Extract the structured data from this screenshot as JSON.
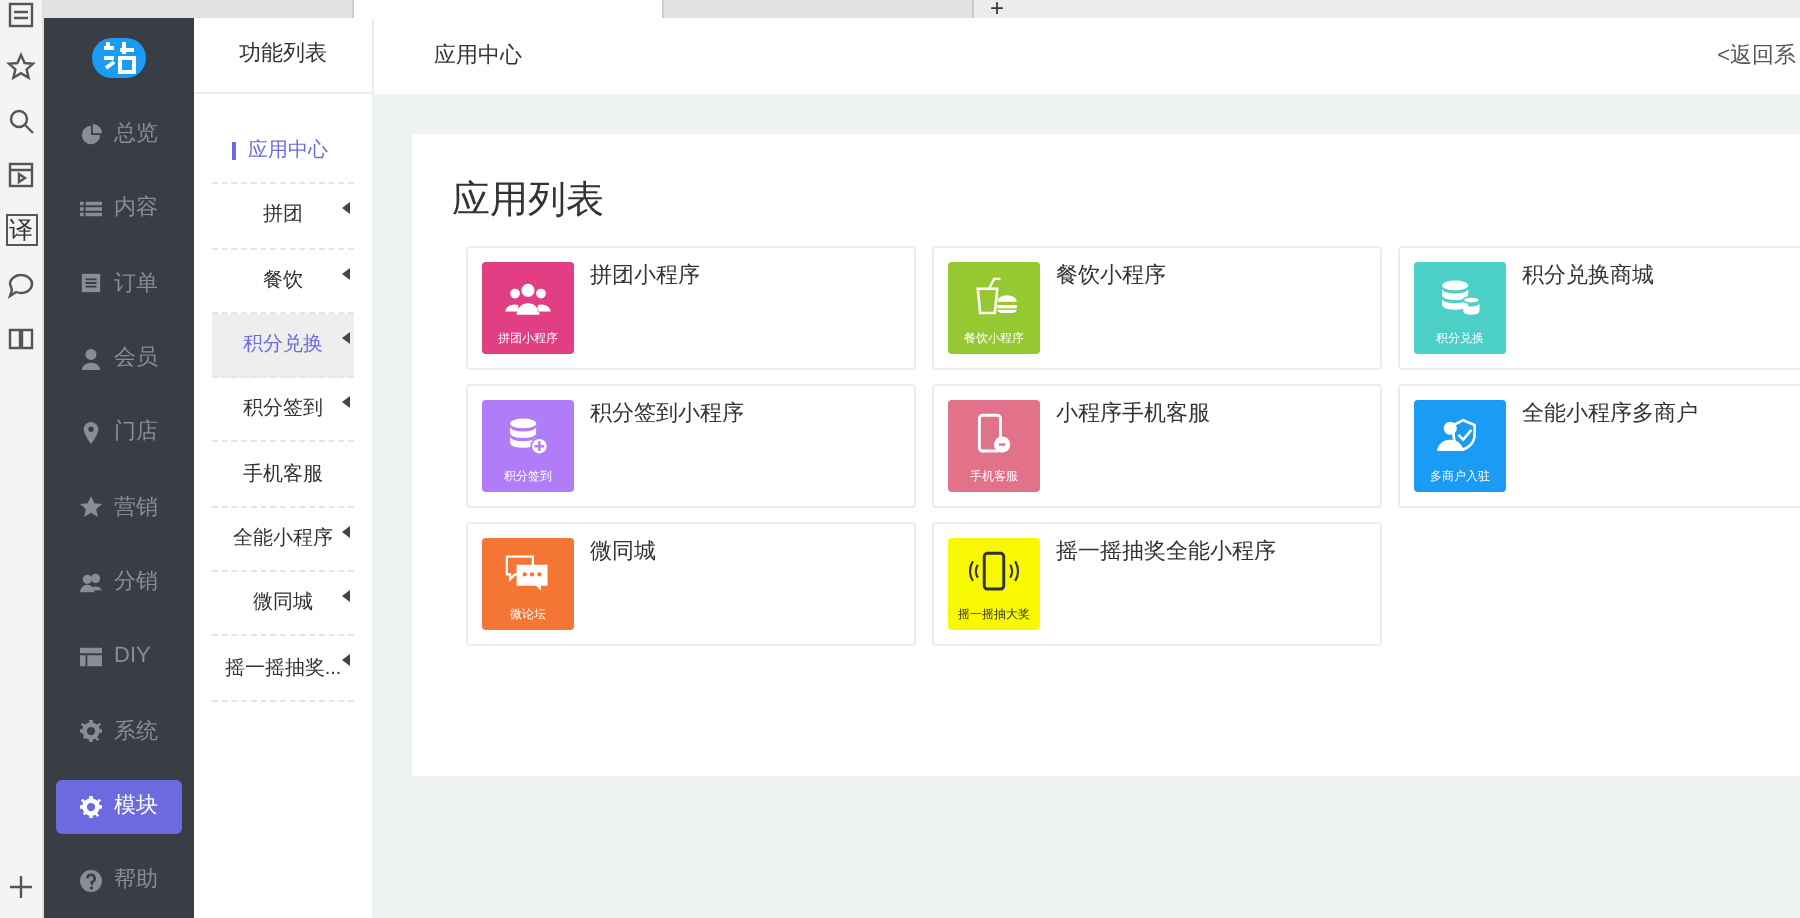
{
  "browser_sidebar": {
    "items": [
      {
        "kind": "list"
      },
      {
        "kind": "star"
      },
      {
        "kind": "search"
      },
      {
        "kind": "video"
      },
      {
        "kind": "glyph",
        "text": "译"
      },
      {
        "kind": "chat"
      },
      {
        "kind": "book"
      },
      {
        "kind": "plus"
      }
    ]
  },
  "browser_tabs": {
    "tabs": [
      {
        "selected": false
      },
      {
        "selected": true
      },
      {
        "selected": false
      }
    ],
    "new_tab": "+"
  },
  "main_nav": {
    "items": [
      {
        "label": "总览",
        "kind": "pie",
        "selected": false
      },
      {
        "label": "内容",
        "kind": "list",
        "selected": false
      },
      {
        "label": "订单",
        "kind": "doc",
        "selected": false
      },
      {
        "label": "会员",
        "kind": "user",
        "selected": false
      },
      {
        "label": "门店",
        "kind": "pin",
        "selected": false
      },
      {
        "label": "营销",
        "kind": "star",
        "selected": false
      },
      {
        "label": "分销",
        "kind": "users",
        "selected": false
      },
      {
        "label": "DIY",
        "kind": "layout",
        "selected": false
      },
      {
        "label": "系统",
        "kind": "gear",
        "selected": false
      },
      {
        "label": "模块",
        "kind": "gear",
        "selected": true
      },
      {
        "label": "帮助",
        "kind": "help",
        "selected": false
      }
    ]
  },
  "sub_nav": {
    "title": "功能列表",
    "items": [
      {
        "label": "应用中心",
        "kind": "heading",
        "selected": false,
        "has_children": false
      },
      {
        "label": "拼团",
        "kind": "item",
        "selected": false,
        "has_children": true
      },
      {
        "label": "餐饮",
        "kind": "item",
        "selected": false,
        "has_children": true
      },
      {
        "label": "积分兑换",
        "kind": "item",
        "selected": true,
        "has_children": true
      },
      {
        "label": "积分签到",
        "kind": "item",
        "selected": false,
        "has_children": true
      },
      {
        "label": "手机客服",
        "kind": "item",
        "selected": false,
        "has_children": false
      },
      {
        "label": "全能小程序",
        "kind": "item",
        "selected": false,
        "has_children": true
      },
      {
        "label": "微同城",
        "kind": "item",
        "selected": false,
        "has_children": true
      },
      {
        "label": "摇一摇抽奖...",
        "kind": "item",
        "selected": false,
        "has_children": true
      }
    ]
  },
  "top_bar": {
    "title": "应用中心",
    "back_link": "<返回系"
  },
  "content": {
    "title": "应用列表",
    "apps": [
      {
        "name": "拼团小程序",
        "kind": "group",
        "icon_label": "拼团小程序",
        "color": "#e23e83"
      },
      {
        "name": "餐饮小程序",
        "kind": "food",
        "icon_label": "餐饮小程序",
        "color": "#96c832"
      },
      {
        "name": "积分兑换商城",
        "kind": "database",
        "icon_label": "积分兑换",
        "color": "#4ccfc6"
      },
      {
        "name": "积分签到小程序",
        "kind": "database-plus",
        "icon_label": "积分签到",
        "color": "#b07cf7"
      },
      {
        "name": "小程序手机客服",
        "kind": "phone",
        "icon_label": "手机客服",
        "color": "#e2718a"
      },
      {
        "name": "全能小程序多商户",
        "kind": "user-shield",
        "icon_label": "多商户入驻",
        "color": "#1a9cf5"
      },
      {
        "name": "微同城",
        "kind": "chat",
        "icon_label": "微论坛",
        "color": "#f47534"
      },
      {
        "name": "摇一摇抽奖全能小程序",
        "kind": "shake",
        "icon_label": "摇一摇抽大奖",
        "color": "#f8f800"
      }
    ]
  }
}
